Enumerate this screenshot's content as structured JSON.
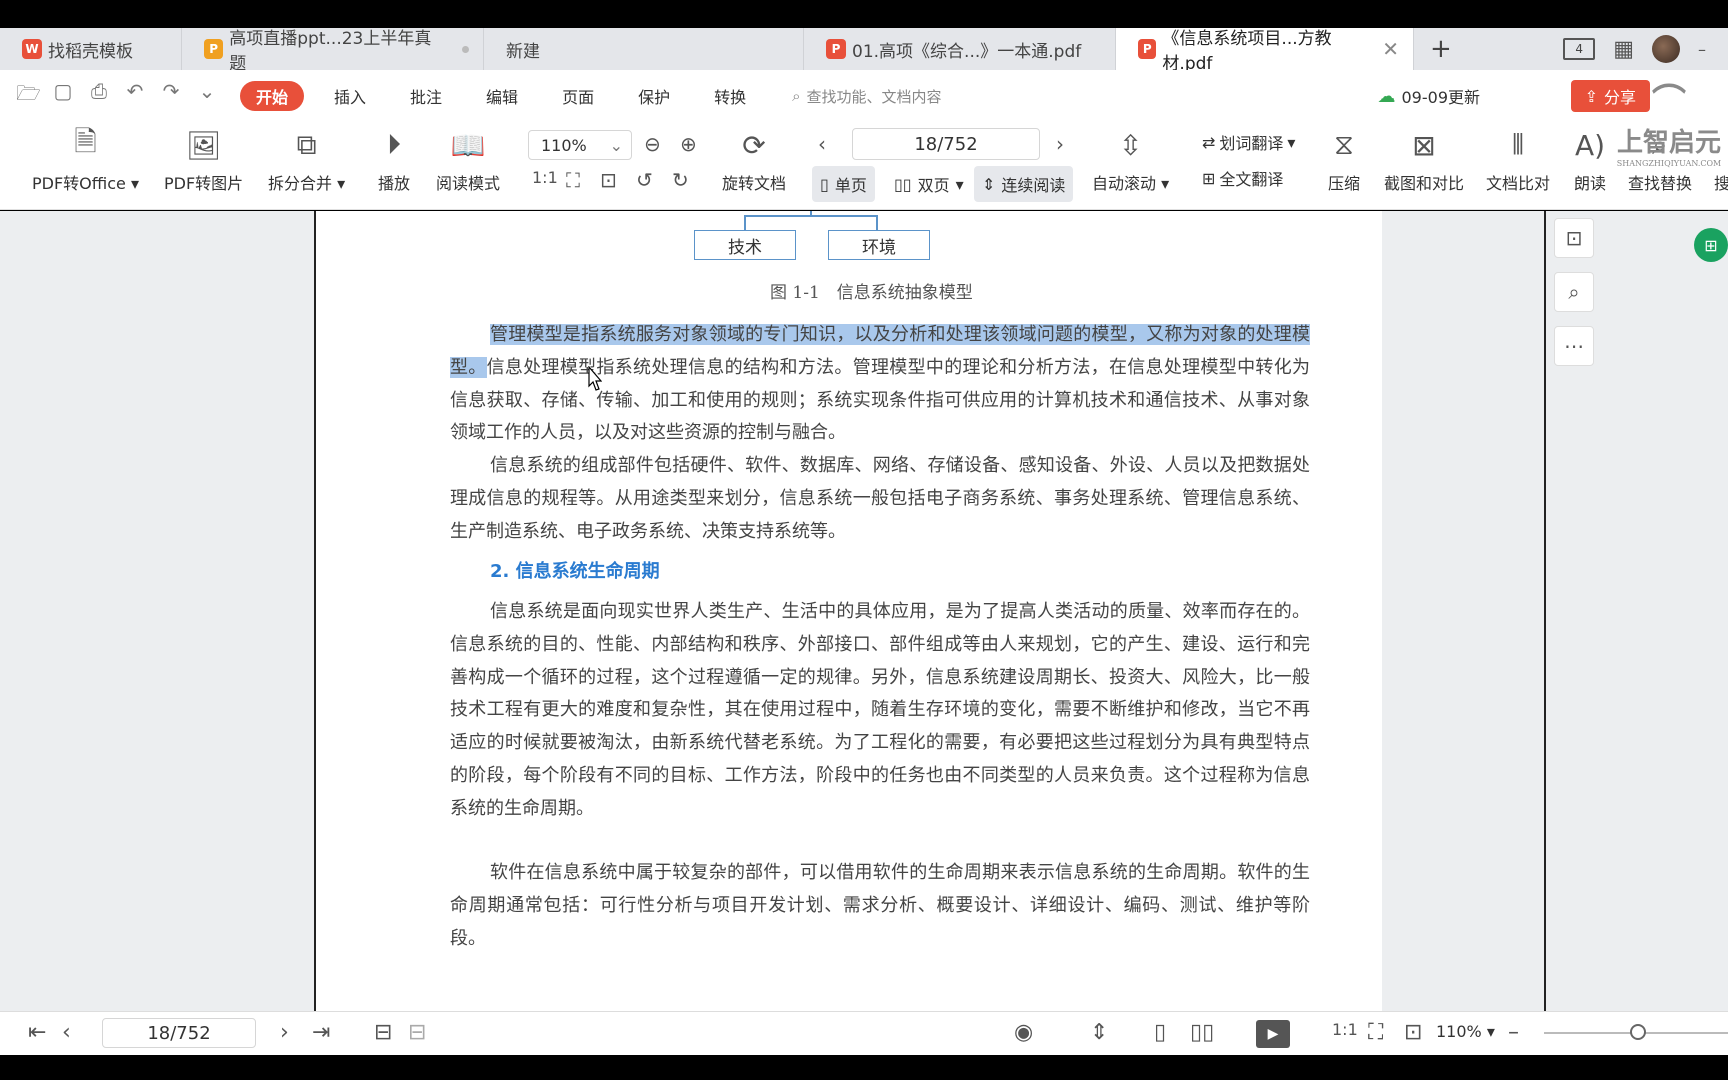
{
  "tabs": [
    {
      "label": "找稻壳模板",
      "icon": "wps-logo-icon",
      "color": "#e8503a"
    },
    {
      "label": "高项直播ppt...23上半年真题",
      "icon": "ppt-icon",
      "color": "#f0a020"
    },
    {
      "label": "新建",
      "icon": "",
      "color": ""
    },
    {
      "label": "01.高项《综合...》一本通.pdf",
      "icon": "pdf-icon",
      "color": "#e8503a"
    },
    {
      "label": "《信息系统项目...方教材.pdf",
      "icon": "pdf-icon",
      "color": "#e8503a"
    }
  ],
  "window": {
    "badge": "4"
  },
  "menu": {
    "items": [
      "开始",
      "插入",
      "批注",
      "编辑",
      "页面",
      "保护",
      "转换"
    ],
    "search_placeholder": "查找功能、文档内容",
    "update_label": "09-09更新",
    "share_label": "分享"
  },
  "toolbar": {
    "pdf_to_office": "PDF转Office",
    "pdf_to_image": "PDF转图片",
    "split_merge": "拆分合并",
    "play": "播放",
    "read_mode": "阅读模式",
    "zoom": "110%",
    "rotate_doc": "旋转文档",
    "page": "18/752",
    "single_page": "单页",
    "double_page": "双页",
    "continuous": "连续阅读",
    "auto_scroll": "自动滚动",
    "word_translate": "划词翻译",
    "full_translate": "全文翻译",
    "compress": "压缩",
    "screenshot_compare": "截图和对比",
    "doc_compare": "文档比对",
    "read_aloud": "朗读",
    "find_replace": "查找替换",
    "search_cut": "搜"
  },
  "watermark": {
    "text": "上智启元",
    "sub": "SHANGZHIQIYUAN.COM"
  },
  "document": {
    "diagram_boxes": [
      "技术",
      "环境"
    ],
    "figure_caption": "图 1-1　信息系统抽象模型",
    "p1_highlight": "管理模型是指系统服务对象领域的专门知识，以及分析和处理该领域问题的模型，又称为对象的处理模型。",
    "p1_rest": "信息处理模型指系统处理信息的结构和方法。管理模型中的理论和分析方法，在信息处理模型中转化为信息获取、存储、传输、加工和使用的规则；系统实现条件指可供应用的计算机技术和通信技术、从事对象领域工作的人员，以及对这些资源的控制与融合。",
    "p2": "信息系统的组成部件包括硬件、软件、数据库、网络、存储设备、感知设备、外设、人员以及把数据处理成信息的规程等。从用途类型来划分，信息系统一般包括电子商务系统、事务处理系统、管理信息系统、生产制造系统、电子政务系统、决策支持系统等。",
    "heading": "2. 信息系统生命周期",
    "p3": "信息系统是面向现实世界人类生产、生活中的具体应用，是为了提高人类活动的质量、效率而存在的。信息系统的目的、性能、内部结构和秩序、外部接口、部件组成等由人来规划，它的产生、建设、运行和完善构成一个循环的过程，这个过程遵循一定的规律。另外，信息系统建设周期长、投资大、风险大，比一般技术工程有更大的难度和复杂性，其在使用过程中，随着生存环境的变化，需要不断维护和修改，当它不再适应的时候就要被淘汰，由新系统代替老系统。为了工程化的需要，有必要把这些过程划分为具有典型特点的阶段，每个阶段有不同的目标、工作方法，阶段中的任务也由不同类型的人员来负责。这个过程称为信息系统的生命周期。",
    "p4": "软件在信息系统中属于较复杂的部件，可以借用软件的生命周期来表示信息系统的生命周期。软件的生命周期通常包括：可行性分析与项目开发计划、需求分析、概要设计、详细设计、编码、测试、维护等阶段。"
  },
  "status": {
    "page": "18/752",
    "zoom": "110%",
    "zoom_slider_fraction": 0.5
  },
  "colors": {
    "accent": "#e8503a",
    "link": "#2a7bd0",
    "highlight": "#a9c8ec"
  }
}
